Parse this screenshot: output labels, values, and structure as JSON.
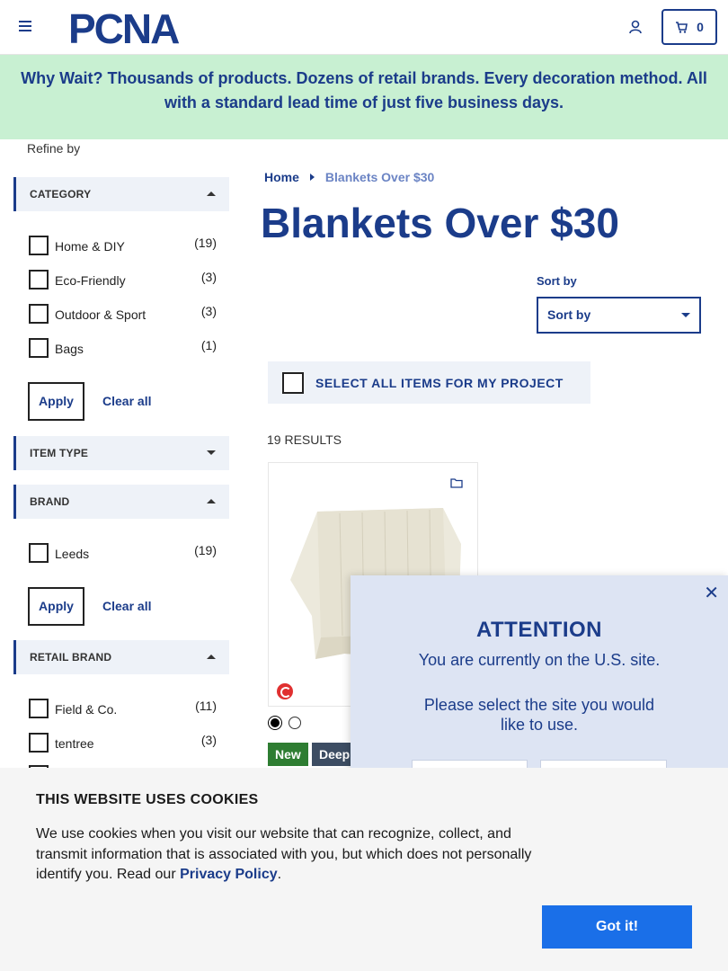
{
  "header": {
    "logo_text": "PCNA",
    "cart_count": "0"
  },
  "banner": {
    "text": "Why Wait? Thousands of products. Dozens of retail brands. Every decoration method. All with a standard lead time of just five business days."
  },
  "sidebar": {
    "refine_label": "Refine by",
    "category": {
      "title": "CATEGORY",
      "options": [
        {
          "label": "Home & DIY",
          "count": "(19)"
        },
        {
          "label": "Eco-Friendly",
          "count": "(3)"
        },
        {
          "label": "Outdoor & Sport",
          "count": "(3)"
        },
        {
          "label": "Bags",
          "count": "(1)"
        }
      ],
      "apply": "Apply",
      "clear": "Clear all"
    },
    "item_type": {
      "title": "ITEM TYPE"
    },
    "brand": {
      "title": "BRAND",
      "options": [
        {
          "label": "Leeds",
          "count": "(19)"
        }
      ],
      "apply": "Apply",
      "clear": "Clear all"
    },
    "retail_brand": {
      "title": "RETAIL BRAND",
      "options": [
        {
          "label": "Field & Co.",
          "count": "(11)"
        },
        {
          "label": "tentree",
          "count": "(3)"
        }
      ]
    }
  },
  "main": {
    "breadcrumb": {
      "home": "Home",
      "current": "Blankets Over $30"
    },
    "title": "Blankets Over $30",
    "sort_label": "Sort by",
    "sort_value": "Sort by",
    "select_all": "SELECT ALL ITEMS FOR MY PROJECT",
    "results": "19 RESULTS",
    "product": {
      "swatches": [
        "#000000",
        "#ffffff"
      ],
      "badges": [
        {
          "text": "New",
          "color": "#2e7d32"
        },
        {
          "text": "Deep",
          "color": "#3d4d63"
        }
      ]
    }
  },
  "modal": {
    "title": "ATTENTION",
    "subtitle": "You are currently on the U.S. site.",
    "question": "Please select the site you would like to use."
  },
  "cookie": {
    "title": "THIS WEBSITE USES COOKIES",
    "body": "We use cookies when you visit our website that can recognize, collect, and transmit information that is associated with you, but which does not personally identify you. Read our ",
    "link": "Privacy Policy",
    "end": ".",
    "button": "Got it!"
  },
  "colors": {
    "brand_blue": "#1b3c8a",
    "banner_green": "#c8f0d2",
    "cookie_button": "#1a6fe8"
  }
}
